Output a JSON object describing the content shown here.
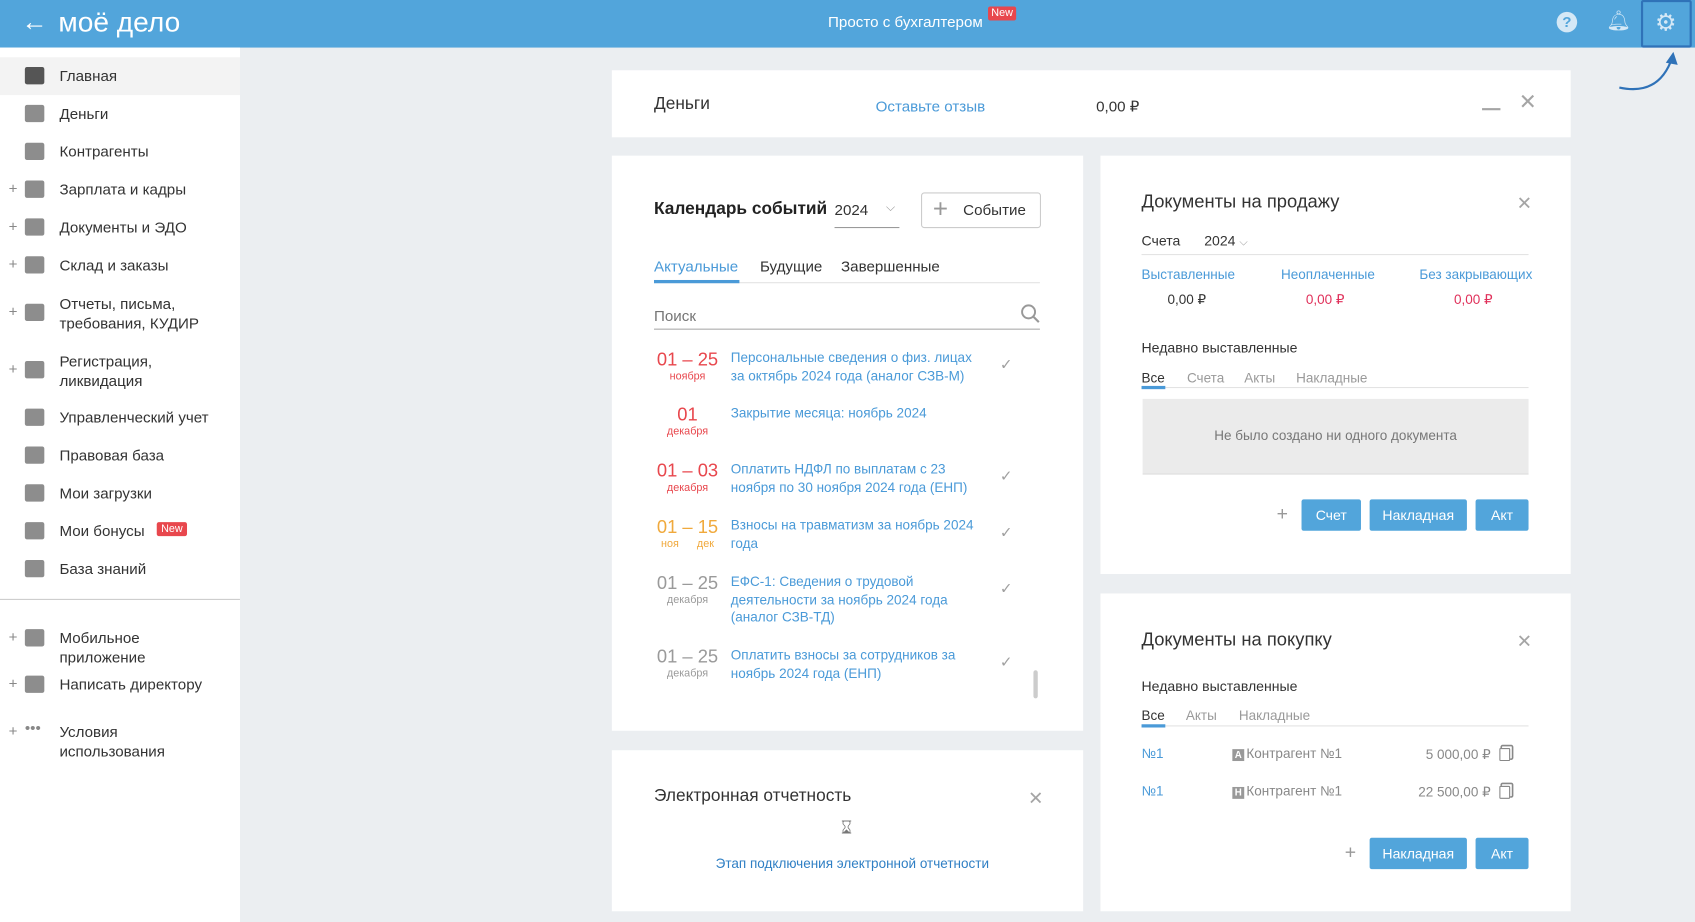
{
  "header": {
    "logo": "моё дело",
    "center_link": "Просто с бухгалтером",
    "center_badge": "New",
    "icons": [
      "back-arrow-icon",
      "help-icon",
      "bell-icon",
      "gear-icon"
    ]
  },
  "sidebar": {
    "items": [
      {
        "label": "Главная",
        "icon": "home-icon",
        "expandable": false,
        "active": true
      },
      {
        "label": "Деньги",
        "icon": "money-icon",
        "expandable": false
      },
      {
        "label": "Контрагенты",
        "icon": "person-icon",
        "expandable": false
      },
      {
        "label": "Зарплата и кадры",
        "icon": "wallet-icon",
        "expandable": true
      },
      {
        "label": "Документы и ЭДО",
        "icon": "folder-icon",
        "expandable": true
      },
      {
        "label": "Склад и заказы",
        "icon": "cart-icon",
        "expandable": true
      },
      {
        "label": "Отчеты, письма, требования, КУДИР",
        "icon": "report-icon",
        "expandable": true
      },
      {
        "label": "Регистрация, ликвидация",
        "icon": "registration-icon",
        "expandable": true
      },
      {
        "label": "Управленческий учет",
        "icon": "ruble-doc-icon",
        "expandable": false
      },
      {
        "label": "Правовая база",
        "icon": "briefcase-icon",
        "expandable": false
      },
      {
        "label": "Мои загрузки",
        "icon": "folder-icon",
        "expandable": false
      },
      {
        "label": "Мои бонусы",
        "icon": "gift-icon",
        "expandable": false,
        "badge": "New"
      },
      {
        "label": "База знаний",
        "icon": "graduation-icon",
        "expandable": false
      },
      {
        "label": "Мобильное приложение",
        "icon": "phone-icon",
        "expandable": true
      },
      {
        "label": "Написать директору",
        "icon": "chat-icon",
        "expandable": true
      },
      {
        "label": "Условия использования",
        "icon": "more-icon",
        "expandable": true
      }
    ]
  },
  "money": {
    "title": "Деньги",
    "feedback_link": "Оставьте отзыв",
    "amount": "0,00 ₽"
  },
  "calendar": {
    "title": "Календарь событий",
    "year": "2024",
    "add_button": "Событие",
    "tabs": [
      "Актуальные",
      "Будущие",
      "Завершенные"
    ],
    "active_tab": 0,
    "search_placeholder": "Поиск",
    "events": [
      {
        "date": "01 – 25",
        "sub": "ноября",
        "text": "Персональные сведения о физ. лицах за октябрь 2024 года (аналог СЗВ-М)",
        "status": "red",
        "check": true
      },
      {
        "date": "01",
        "sub": "декабря",
        "text": "Закрытие месяца: ноябрь 2024",
        "status": "red",
        "check": false
      },
      {
        "date": "01 – 03",
        "sub": "декабря",
        "text": "Оплатить НДФЛ по выплатам с 23 ноября по 30 ноября 2024 года (ЕНП)",
        "status": "red",
        "check": true
      },
      {
        "date": "01 – 15",
        "sub": "ноя      дек",
        "text": "Взносы на травматизм за ноябрь 2024 года",
        "status": "orange",
        "check": true
      },
      {
        "date": "01 – 25",
        "sub": "декабря",
        "text": "ЕФС-1: Сведения о трудовой деятельности за ноябрь 2024 года (аналог СЗВ-ТД)",
        "status": "gray",
        "check": true
      },
      {
        "date": "01 – 25",
        "sub": "декабря",
        "text": "Оплатить взносы за сотрудников за ноябрь 2024 года (ЕНП)",
        "status": "gray",
        "check": true
      }
    ]
  },
  "ereport": {
    "title": "Электронная отчетность",
    "link": "Этап подключения электронной отчетности"
  },
  "sales": {
    "title": "Документы на продажу",
    "filter_label": "Счета",
    "year": "2024",
    "stats": [
      {
        "label": "Выставленные",
        "value": "0,00 ₽"
      },
      {
        "label": "Неоплаченные",
        "value": "0,00 ₽"
      },
      {
        "label": "Без закрывающих",
        "value": "0,00 ₽"
      }
    ],
    "recent_title": "Недавно выставленные",
    "tabs": [
      "Все",
      "Счета",
      "Акты",
      "Накладные"
    ],
    "empty": "Не было создано ни одного документа",
    "buttons": [
      "Счет",
      "Накладная",
      "Акт"
    ],
    "plus": "+"
  },
  "purchase": {
    "title": "Документы на покупку",
    "recent_title": "Недавно выставленные",
    "tabs": [
      "Все",
      "Акты",
      "Накладные"
    ],
    "rows": [
      {
        "number": "№1",
        "type": "A",
        "counterparty": "Контрагент №1",
        "amount": "5 000,00 ₽"
      },
      {
        "number": "№1",
        "type": "Н",
        "counterparty": "Контрагент №1",
        "amount": "22 500,00 ₽"
      }
    ],
    "buttons": [
      "Накладная",
      "Акт"
    ],
    "plus": "+"
  },
  "colors": {
    "header": "#52a5db",
    "accent": "#4a9ad8",
    "danger": "#e8474d",
    "warning": "#f0a93c",
    "background": "#ebeef1"
  }
}
